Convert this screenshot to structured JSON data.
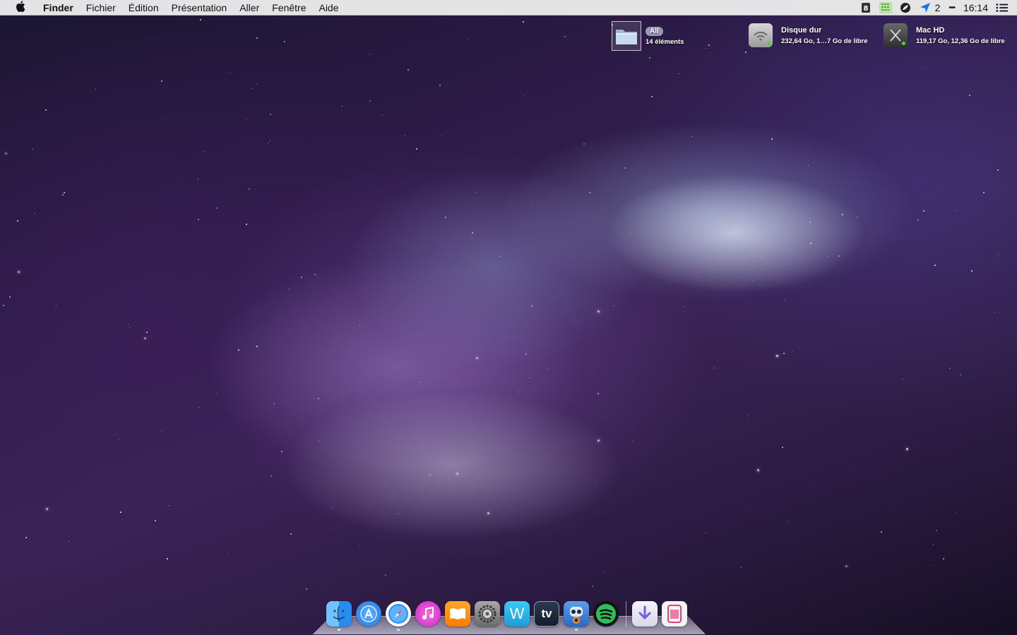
{
  "menubar": {
    "app_name": "Finder",
    "menus": [
      "Fichier",
      "Édition",
      "Présentation",
      "Aller",
      "Fenêtre",
      "Aide"
    ],
    "status": {
      "notification_count": "2",
      "clock": "16:14",
      "more_glyph": "•••"
    }
  },
  "desktop_widgets": {
    "folder": {
      "badge": "All",
      "subtitle": "14 éléments"
    },
    "disk_1": {
      "title": "Disque dur",
      "subtitle": "232,64 Go, 1…7 Go de libre"
    },
    "disk_2": {
      "title": "Mac HD",
      "subtitle": "119,17 Go, 12,36 Go de libre"
    }
  },
  "dock": {
    "apps": [
      {
        "name": "finder-icon",
        "color": "#2a8cf0"
      },
      {
        "name": "app-store-icon",
        "color": "#1d7fe8"
      },
      {
        "name": "safari-icon",
        "color": "#ffffff"
      },
      {
        "name": "itunes-icon",
        "color": "#e83cc0"
      },
      {
        "name": "ibooks-icon",
        "color": "#ff8a00"
      },
      {
        "name": "system-preferences-icon",
        "color": "#8a8a8a"
      },
      {
        "name": "word-icon",
        "color": "#22b6e8"
      },
      {
        "name": "tv-icon",
        "color": "#1f2a3c"
      },
      {
        "name": "tweetbot-icon",
        "color": "#3a7fd5"
      },
      {
        "name": "spotify-icon",
        "color": "#1c1c1c"
      }
    ],
    "right_items": [
      {
        "name": "downloads-icon",
        "color": "#e8e8f2"
      },
      {
        "name": "trash-icon",
        "color": "#f4f4f6"
      }
    ],
    "labels": {
      "word_letter": "W",
      "tv_letters": "tv"
    }
  }
}
